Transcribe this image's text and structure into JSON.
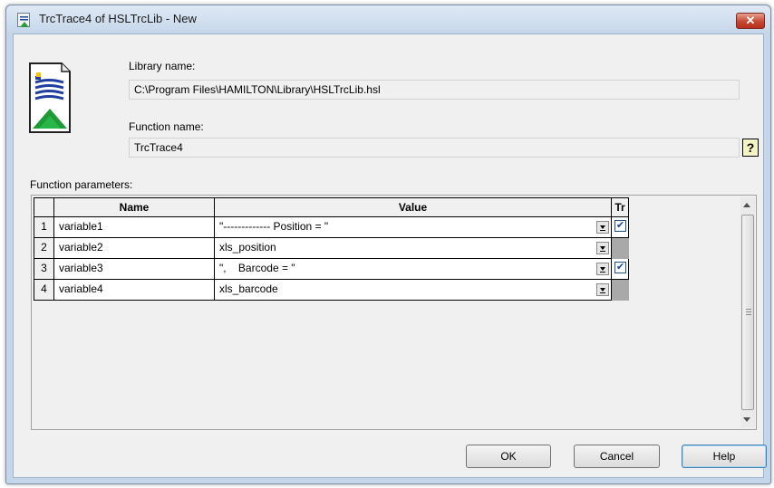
{
  "window": {
    "title": "TrcTrace4 of HSLTrcLib - New",
    "close_label": "✕"
  },
  "library": {
    "label": "Library name:",
    "value": "C:\\Program Files\\HAMILTON\\Library\\HSLTrcLib.hsl"
  },
  "function": {
    "label": "Function name:",
    "value": "TrcTrace4"
  },
  "help_icon_label": "?",
  "params": {
    "label": "Function parameters:",
    "headers": {
      "name": "Name",
      "value": "Value",
      "tr": "Tr"
    },
    "rows": [
      {
        "num": "1",
        "name": "variable1",
        "value": "\"------------- Position = \"",
        "tr": true
      },
      {
        "num": "2",
        "name": "variable2",
        "value": "xls_position",
        "tr": null
      },
      {
        "num": "3",
        "name": "variable3",
        "value": "\",    Barcode = \"",
        "tr": true
      },
      {
        "num": "4",
        "name": "variable4",
        "value": "xls_barcode",
        "tr": null
      }
    ]
  },
  "buttons": {
    "ok": "OK",
    "cancel": "Cancel",
    "help": "Help"
  },
  "colors": {
    "accent": "#3c7fb1",
    "close": "#c64833",
    "checkmark": "#21409a"
  }
}
